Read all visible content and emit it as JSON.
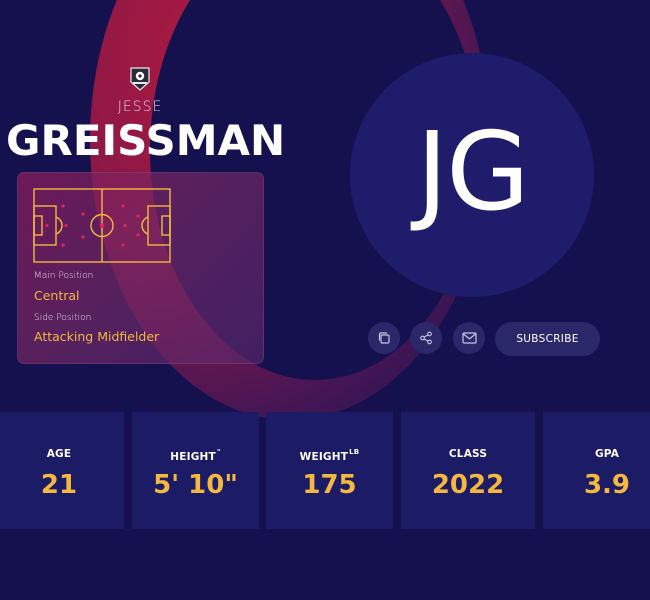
{
  "profile": {
    "first_name": "JESSE",
    "last_name": "GREISSMAN",
    "initials": "JG"
  },
  "positions": {
    "main_label": "Main Position",
    "main_value": "Central",
    "side_label": "Side Position",
    "side_value": "Attacking Midfielder"
  },
  "actions": {
    "copy_icon": "copy-icon",
    "share_icon": "share-icon",
    "mail_icon": "mail-icon",
    "subscribe_label": "SUBSCRIBE"
  },
  "stats": [
    {
      "label": "AGE",
      "unit": "",
      "value": "21"
    },
    {
      "label": "HEIGHT",
      "unit": "\"",
      "value": "5' 10\""
    },
    {
      "label": "WEIGHT",
      "unit": "LB",
      "value": "175"
    },
    {
      "label": "CLASS",
      "unit": "",
      "value": "2022"
    },
    {
      "label": "GPA",
      "unit": "",
      "value": "3.9"
    }
  ],
  "colors": {
    "background": "#15114e",
    "accent": "#f4b740",
    "card": "#1c1b66"
  }
}
